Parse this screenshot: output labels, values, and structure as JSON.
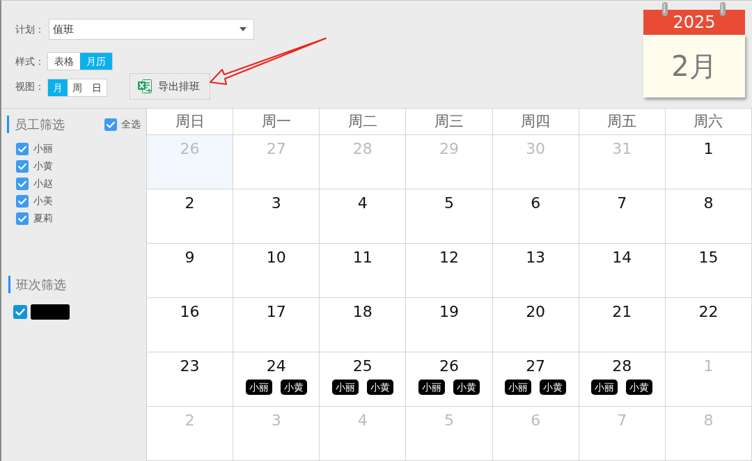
{
  "toolbar": {
    "plan": {
      "label": "计划：",
      "value": "值班"
    },
    "style": {
      "label": "样式：",
      "options": [
        {
          "label": "表格",
          "selected": false
        },
        {
          "label": "月历",
          "selected": true
        }
      ]
    },
    "view": {
      "label": "视图：",
      "options": [
        {
          "label": "月",
          "selected": true
        },
        {
          "label": "周",
          "selected": false
        },
        {
          "label": "日",
          "selected": false
        }
      ]
    },
    "export_button": "导出排班"
  },
  "month_card": {
    "year": "2025",
    "month": "2月"
  },
  "sidebar": {
    "employee_filter": {
      "title": "员工筛选",
      "select_all": {
        "label": "全选",
        "checked": true
      },
      "items": [
        {
          "label": "小丽",
          "checked": true
        },
        {
          "label": "小黄",
          "checked": true
        },
        {
          "label": "小赵",
          "checked": true
        },
        {
          "label": "小美",
          "checked": true
        },
        {
          "label": "夏莉",
          "checked": true
        }
      ]
    },
    "shift_filter": {
      "title": "班次筛选",
      "items": [
        {
          "checked": true,
          "color": "#000000"
        }
      ]
    }
  },
  "calendar": {
    "weekdays": [
      "周日",
      "周一",
      "周二",
      "周三",
      "周四",
      "周五",
      "周六"
    ],
    "weeks": [
      [
        {
          "date": "26",
          "other_month": true,
          "selected": true
        },
        {
          "date": "27",
          "other_month": true,
          "selected": false
        },
        {
          "date": "28",
          "other_month": true,
          "selected": false
        },
        {
          "date": "29",
          "other_month": true,
          "selected": false
        },
        {
          "date": "30",
          "other_month": true,
          "selected": false
        },
        {
          "date": "31",
          "other_month": true,
          "selected": false
        },
        {
          "date": "1",
          "other_month": false,
          "selected": false
        }
      ],
      [
        {
          "date": "2",
          "other_month": false,
          "selected": false
        },
        {
          "date": "3",
          "other_month": false,
          "selected": false
        },
        {
          "date": "4",
          "other_month": false,
          "selected": false
        },
        {
          "date": "5",
          "other_month": false,
          "selected": false
        },
        {
          "date": "6",
          "other_month": false,
          "selected": false
        },
        {
          "date": "7",
          "other_month": false,
          "selected": false
        },
        {
          "date": "8",
          "other_month": false,
          "selected": false
        }
      ],
      [
        {
          "date": "9",
          "other_month": false,
          "selected": false
        },
        {
          "date": "10",
          "other_month": false,
          "selected": false
        },
        {
          "date": "11",
          "other_month": false,
          "selected": false
        },
        {
          "date": "12",
          "other_month": false,
          "selected": false
        },
        {
          "date": "13",
          "other_month": false,
          "selected": false
        },
        {
          "date": "14",
          "other_month": false,
          "selected": false
        },
        {
          "date": "15",
          "other_month": false,
          "selected": false
        }
      ],
      [
        {
          "date": "16",
          "other_month": false,
          "selected": false
        },
        {
          "date": "17",
          "other_month": false,
          "selected": false
        },
        {
          "date": "18",
          "other_month": false,
          "selected": false
        },
        {
          "date": "19",
          "other_month": false,
          "selected": false
        },
        {
          "date": "20",
          "other_month": false,
          "selected": false
        },
        {
          "date": "21",
          "other_month": false,
          "selected": false
        },
        {
          "date": "22",
          "other_month": false,
          "selected": false
        }
      ],
      [
        {
          "date": "23",
          "other_month": false,
          "selected": false
        },
        {
          "date": "24",
          "other_month": false,
          "selected": false,
          "events": [
            "小丽",
            "小黄"
          ]
        },
        {
          "date": "25",
          "other_month": false,
          "selected": false,
          "events": [
            "小丽",
            "小黄"
          ]
        },
        {
          "date": "26",
          "other_month": false,
          "selected": false,
          "events": [
            "小丽",
            "小黄"
          ]
        },
        {
          "date": "27",
          "other_month": false,
          "selected": false,
          "events": [
            "小丽",
            "小黄"
          ]
        },
        {
          "date": "28",
          "other_month": false,
          "selected": false,
          "events": [
            "小丽",
            "小黄"
          ]
        },
        {
          "date": "1",
          "other_month": true,
          "selected": false
        }
      ],
      [
        {
          "date": "2",
          "other_month": true,
          "selected": false
        },
        {
          "date": "3",
          "other_month": true,
          "selected": false
        },
        {
          "date": "4",
          "other_month": true,
          "selected": false
        },
        {
          "date": "5",
          "other_month": true,
          "selected": false
        },
        {
          "date": "6",
          "other_month": true,
          "selected": false
        },
        {
          "date": "7",
          "other_month": true,
          "selected": false
        },
        {
          "date": "8",
          "other_month": true,
          "selected": false
        }
      ]
    ]
  }
}
